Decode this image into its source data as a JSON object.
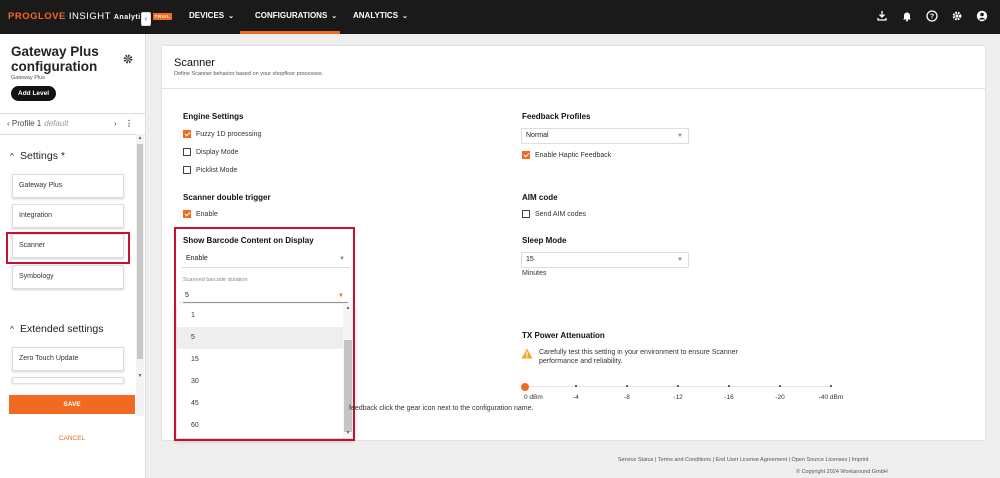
{
  "topbar": {
    "brand_part1": "PROGLOVE",
    "brand_part2": "INSIGHT",
    "brand_part3": "Analytics",
    "trial_badge": "TRIAL",
    "nav": [
      "DEVICES",
      "CONFIGURATIONS",
      "ANALYTICS"
    ],
    "active_nav": "CONFIGURATIONS",
    "icons": [
      "download-icon",
      "bell-icon",
      "help-icon",
      "gear-icon",
      "account-icon"
    ],
    "accent_color": "#f26a21"
  },
  "sidebar": {
    "title": "Gateway Plus configuration",
    "subtitle": "Gateway Plus",
    "add_level": "Add Level",
    "profile_label": "Profile 1",
    "profile_default": "default",
    "settings_header": "Settings *",
    "settings_items": [
      "Gateway Plus",
      "Integration",
      "Scanner",
      "Symbology"
    ],
    "selected_item": "Scanner",
    "extended_header": "Extended settings",
    "extended_items": [
      "Zero Touch Update"
    ],
    "save": "SAVE",
    "cancel": "CANCEL"
  },
  "panel": {
    "title": "Scanner",
    "description": "Define Scanner behavior based on your shopfloor processes.",
    "engine": {
      "title": "Engine Settings",
      "options": [
        {
          "label": "Fuzzy 1D processing",
          "checked": true
        },
        {
          "label": "Display Mode",
          "checked": false
        },
        {
          "label": "Picklist Mode",
          "checked": false
        }
      ]
    },
    "double_trigger": {
      "title": "Scanner double trigger",
      "label": "Enable",
      "checked": true
    },
    "barcode_display": {
      "title": "Show Barcode Content on Display",
      "value": "Enable",
      "duration_label": "Scanned barcode duration",
      "duration_value": "5",
      "duration_options": [
        "1",
        "5",
        "15",
        "30",
        "45",
        "60"
      ]
    },
    "feedback": {
      "title": "Feedback Profiles",
      "value": "Normal",
      "haptic_label": "Enable Haptic Feedback",
      "haptic_checked": true
    },
    "aim": {
      "title": "AIM code",
      "label": "Send AIM codes",
      "checked": false
    },
    "sleep": {
      "title": "Sleep Mode",
      "value": "15",
      "unit": "Minutes"
    },
    "tx_power": {
      "title": "TX Power Attenuation",
      "warning": "Carefully test this setting in your environment to ensure Scanner performance and reliability.",
      "levels": [
        "0 dBm",
        "-4",
        "-8",
        "-12",
        "-16",
        "-20",
        "-40 dBm"
      ],
      "selected": "0 dBm"
    },
    "hint": "feedback click the gear icon next to the configuration name."
  },
  "footer": {
    "links": "Service Status | Terms and Conditions | End User License Agreement | Open Source Licenses | Imprint",
    "copyright": "© Copyright 2024 Workaround GmbH"
  }
}
